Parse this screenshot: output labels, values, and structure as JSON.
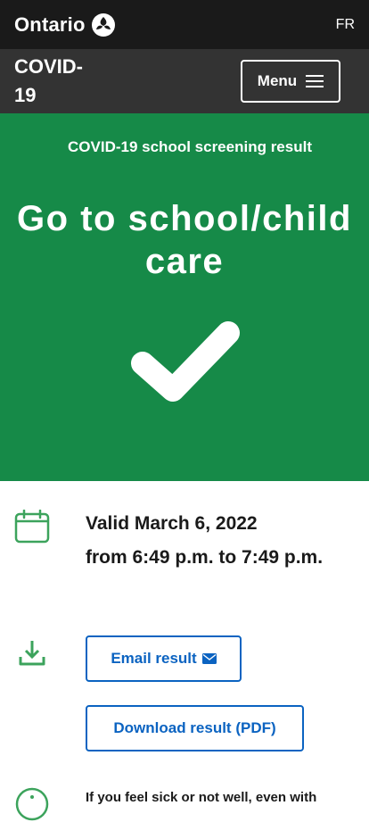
{
  "topbar": {
    "brand": "Ontario",
    "lang": "FR"
  },
  "header": {
    "title": "COVID-19",
    "menu_label": "Menu"
  },
  "banner": {
    "subtitle": "COVID-19 school screening result",
    "result": "Go to school/child care",
    "color": "#168a48"
  },
  "validity": {
    "line1": "Valid March 6, 2022",
    "line2": "from 6:49 p.m. to 7:49 p.m."
  },
  "actions": {
    "email_label": "Email result",
    "download_label": "Download result (PDF)",
    "accent": "#0b63c1"
  },
  "notice": {
    "text": "If you feel sick or not well, even with"
  },
  "icons": {
    "calendar": "calendar-icon",
    "download": "download-icon",
    "info": "info-icon",
    "mail": "mail-icon",
    "check": "checkmark-icon"
  }
}
